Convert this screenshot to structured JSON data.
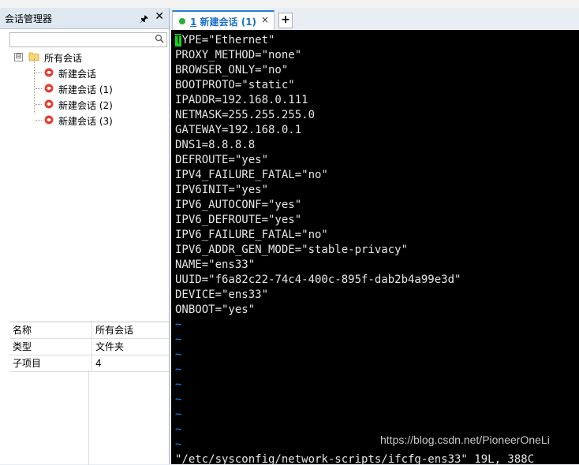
{
  "session_panel": {
    "title": "会话管理器",
    "pin_glyph": "🖈",
    "close_glyph": "✕",
    "search": {
      "value": "",
      "placeholder": ""
    }
  },
  "tree": {
    "root": {
      "label": "所有会话",
      "expander": "⊟"
    },
    "children": [
      {
        "label": "新建会话"
      },
      {
        "label": "新建会话 (1)"
      },
      {
        "label": "新建会话 (2)"
      },
      {
        "label": "新建会话 (3)"
      }
    ]
  },
  "properties": {
    "rows": [
      {
        "key": "名称",
        "value": "所有会话"
      },
      {
        "key": "类型",
        "value": "文件夹"
      },
      {
        "key": "子项目",
        "value": "4"
      }
    ]
  },
  "tabs": [
    {
      "number": "1",
      "title": "新建会话 (1)",
      "close": "×",
      "status_color": "#25b033"
    }
  ],
  "add_tab_glyph": "+",
  "terminal": {
    "cursor_char": "T",
    "first_line_rest": "YPE=\"Ethernet\"",
    "lines": [
      "PROXY_METHOD=\"none\"",
      "BROWSER_ONLY=\"no\"",
      "BOOTPROTO=\"static\"",
      "IPADDR=192.168.0.111",
      "NETMASK=255.255.255.0",
      "GATEWAY=192.168.0.1",
      "DNS1=8.8.8.8",
      "DEFROUTE=\"yes\"",
      "IPV4_FAILURE_FATAL=\"no\"",
      "IPV6INIT=\"yes\"",
      "IPV6_AUTOCONF=\"yes\"",
      "IPV6_DEFROUTE=\"yes\"",
      "IPV6_FAILURE_FATAL=\"no\"",
      "IPV6_ADDR_GEN_MODE=\"stable-privacy\"",
      "NAME=\"ens33\"",
      "UUID=\"f6a82c22-74c4-400c-895f-dab2b4a99e3d\"",
      "DEVICE=\"ens33\"",
      "ONBOOT=\"yes\""
    ],
    "tildes": [
      "~",
      "~",
      "~",
      "~",
      "~",
      "~",
      "~",
      "~",
      "~"
    ],
    "status_line": "\"/etc/sysconfig/network-scripts/ifcfg-ens33\" 19L, 388C",
    "watermark": "https://blog.csdn.net/PioneerOneLi"
  },
  "colors": {
    "cursor": "#17d117",
    "tilde": "#1e90ff",
    "accent": "#2b7cd3"
  }
}
